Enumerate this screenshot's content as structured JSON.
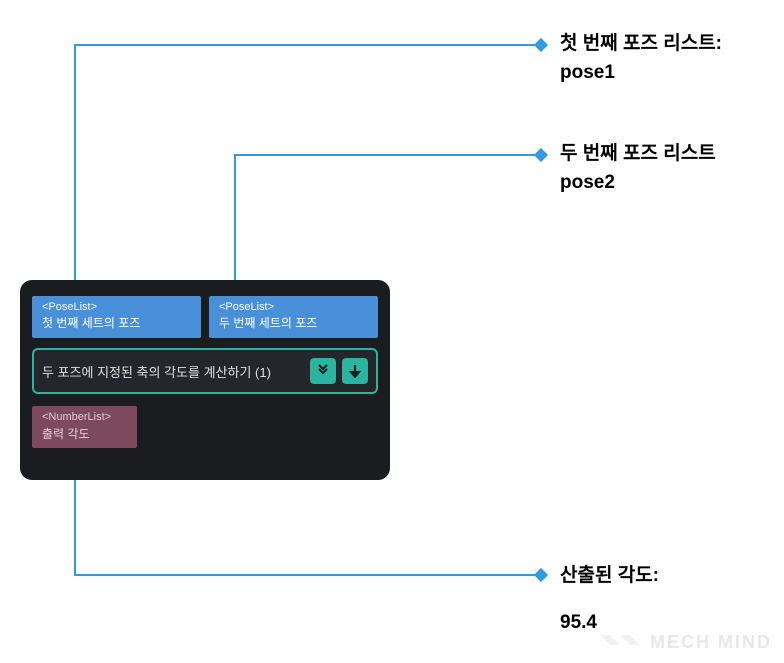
{
  "annotations": {
    "first_pose": {
      "title": "첫 번째 포즈 리스트:",
      "value": "pose1"
    },
    "second_pose": {
      "title": "두 번째 포즈 리스트",
      "value": "pose2"
    },
    "output": {
      "title": "산출된 각도:",
      "value": "95.4"
    }
  },
  "node": {
    "input1": {
      "type": "<PoseList>",
      "label": "첫 번째 세트의 포즈"
    },
    "input2": {
      "type": "<PoseList>",
      "label": "두 번째 세트의 포즈"
    },
    "title": "두 포즈에 지정된 축의 각도를 계산하기 (1)",
    "output": {
      "type": "<NumberList>",
      "label": "출력 각도"
    }
  },
  "watermark": "MECH MIND"
}
